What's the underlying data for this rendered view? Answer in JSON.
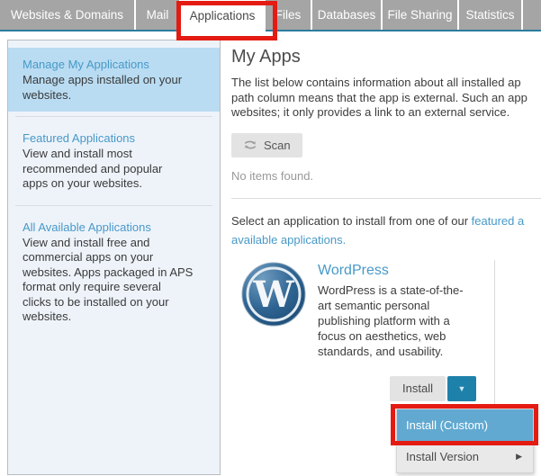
{
  "colors": {
    "tab_bg": "#a5a5a5",
    "teal_line": "#2b7d9e",
    "annotation_red": "#e41b12",
    "link_blue": "#4799c8",
    "sidebar_bg": "#eef3fa",
    "sidebar_active_bg": "#b9dcf2",
    "dropdown_blue": "#1e81a9",
    "menu_highlight": "#61a9d1"
  },
  "tabs": {
    "items": [
      {
        "label": "Websites & Domains",
        "active": false
      },
      {
        "label": "Mail",
        "active": false
      },
      {
        "label": "Applications",
        "active": true
      },
      {
        "label": "Files",
        "active": false
      },
      {
        "label": "Databases",
        "active": false
      },
      {
        "label": "File Sharing",
        "active": false
      },
      {
        "label": "Statistics",
        "active": false
      }
    ]
  },
  "sidebar": {
    "items": [
      {
        "title": "Manage My Applications",
        "desc_lines": [
          "Manage apps installed on your",
          "websites."
        ],
        "active": true
      },
      {
        "title": "Featured Applications",
        "desc_lines": [
          "View and install most",
          "recommended and popular",
          "apps on your websites."
        ],
        "active": false
      },
      {
        "title": "All Available Applications",
        "desc_lines": [
          "View and install free and",
          "commercial apps on your",
          "websites. Apps packaged in APS",
          "format only require several",
          "clicks to be installed on your",
          "websites."
        ],
        "active": false
      }
    ]
  },
  "main": {
    "title": "My Apps",
    "intro_lines": [
      "The list below contains information about all installed ap",
      "path column means that the app is external. Such an app",
      "websites; it only provides a link to an external service."
    ],
    "scan_button_label": "Scan",
    "empty_text": "No items found.",
    "select_prompt": {
      "prefix": "Select an application to install from one of our ",
      "link1": "featured a",
      "link2": "available applications."
    },
    "app_card": {
      "name": "WordPress",
      "logo_letter": "W",
      "desc_lines": [
        "WordPress is a state-of-the-",
        "art semantic personal",
        "publishing platform with a",
        "focus on aesthetics, web",
        "standards, and usability."
      ],
      "install_button_label": "Install",
      "dropdown_arrow": "▼",
      "menu": {
        "items": [
          {
            "label": "Install (Custom)",
            "highlighted": true,
            "submenu": false
          },
          {
            "label": "Install Version",
            "highlighted": false,
            "submenu": true
          }
        ]
      },
      "submenu_arrow": "▶"
    }
  }
}
